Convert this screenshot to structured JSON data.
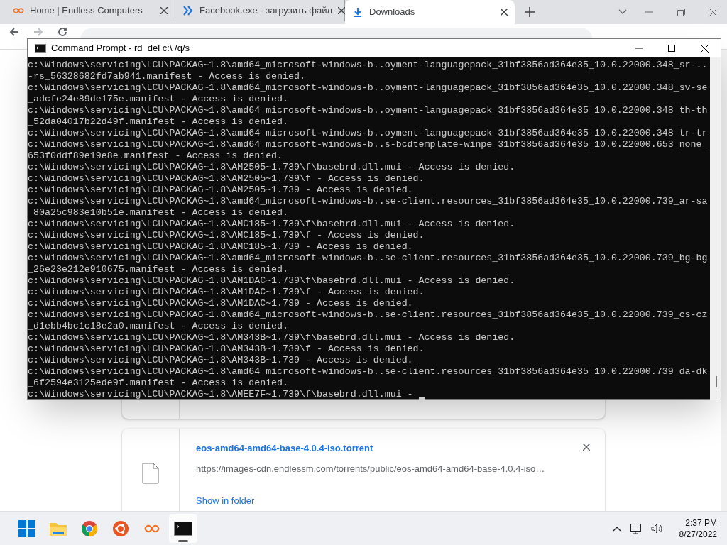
{
  "browser": {
    "tabs": [
      {
        "title": "Home | Endless Computers",
        "selected": false
      },
      {
        "title": "Facebook.exe - загрузить файл",
        "selected": false
      },
      {
        "title": "Downloads",
        "selected": true
      }
    ]
  },
  "downloads": [
    {
      "kind": "hidden"
    },
    {
      "kind": "file",
      "name": "eos-amd64-amd64-base-4.0.4-iso.torrent",
      "url": "https://images-cdn.endlessm.com/torrents/public/eos-amd64-amd64-base-4.0.4-iso…",
      "action": "Show in folder"
    }
  ],
  "console": {
    "title": "Command Prompt - rd  del c:\\ /q/s",
    "lines": [
      "c:\\Windows\\servicing\\LCU\\PACKAG~1.8\\amd64_microsoft-windows-b..oyment-languagepack_31bf3856ad364e35_10.0.22000.348_sr-..",
      "-rs_56328682fd7ab941.manifest - Access is denied.",
      "c:\\Windows\\servicing\\LCU\\PACKAG~1.8\\amd64_microsoft-windows-b..oyment-languagepack_31bf3856ad364e35_10.0.22000.348_sv-se",
      "_adcfe24e89de175e.manifest - Access is denied.",
      "c:\\Windows\\servicing\\LCU\\PACKAG~1.8\\amd64_microsoft-windows-b..oyment-languagepack_31bf3856ad364e35_10.0.22000.348_th-th",
      "_52da04017b22d49f.manifest - Access is denied.",
      "c:\\Windows\\servicing\\LCU\\PACKAG~1.8\\amd64 microsoft-windows-b..oyment-languagepack 31bf3856ad364e35 10.0.22000.348 tr-tr",
      "c:\\Windows\\servicing\\LCU\\PACKAG~1.8\\amd64_microsoft-windows-b..s-bcdtemplate-winpe_31bf3856ad364e35_10.0.22000.653_none_",
      "653f0ddf89e19e8e.manifest - Access is denied.",
      "c:\\Windows\\servicing\\LCU\\PACKAG~1.8\\AM2505~1.739\\f\\basebrd.dll.mui - Access is denied.",
      "c:\\Windows\\servicing\\LCU\\PACKAG~1.8\\AM2505~1.739\\f - Access is denied.",
      "c:\\Windows\\servicing\\LCU\\PACKAG~1.8\\AM2505~1.739 - Access is denied.",
      "c:\\Windows\\servicing\\LCU\\PACKAG~1.8\\amd64_microsoft-windows-b..se-client.resources_31bf3856ad364e35_10.0.22000.739_ar-sa",
      "_80a25c983e10b51e.manifest - Access is denied.",
      "c:\\Windows\\servicing\\LCU\\PACKAG~1.8\\AMC185~1.739\\f\\basebrd.dll.mui - Access is denied.",
      "c:\\Windows\\servicing\\LCU\\PACKAG~1.8\\AMC185~1.739\\f - Access is denied.",
      "c:\\Windows\\servicing\\LCU\\PACKAG~1.8\\AMC185~1.739 - Access is denied.",
      "c:\\Windows\\servicing\\LCU\\PACKAG~1.8\\amd64_microsoft-windows-b..se-client.resources_31bf3856ad364e35_10.0.22000.739_bg-bg",
      "_26e23e212e910675.manifest - Access is denied.",
      "c:\\Windows\\servicing\\LCU\\PACKAG~1.8\\AM1DAC~1.739\\f\\basebrd.dll.mui - Access is denied.",
      "c:\\Windows\\servicing\\LCU\\PACKAG~1.8\\AM1DAC~1.739\\f - Access is denied.",
      "c:\\Windows\\servicing\\LCU\\PACKAG~1.8\\AM1DAC~1.739 - Access is denied.",
      "c:\\Windows\\servicing\\LCU\\PACKAG~1.8\\amd64_microsoft-windows-b..se-client.resources_31bf3856ad364e35_10.0.22000.739_cs-cz",
      "_d1ebb4bc1c18e2a0.manifest - Access is denied.",
      "c:\\Windows\\servicing\\LCU\\PACKAG~1.8\\AM343B~1.739\\f\\basebrd.dll.mui - Access is denied.",
      "c:\\Windows\\servicing\\LCU\\PACKAG~1.8\\AM343B~1.739\\f - Access is denied.",
      "c:\\Windows\\servicing\\LCU\\PACKAG~1.8\\AM343B~1.739 - Access is denied.",
      "c:\\Windows\\servicing\\LCU\\PACKAG~1.8\\amd64_microsoft-windows-b..se-client.resources_31bf3856ad364e35_10.0.22000.739_da-dk",
      "_6f2594e3125ede9f.manifest - Access is denied.",
      "c:\\Windows\\servicing\\LCU\\PACKAG~1.8\\AMEE7F~1.739\\f\\basebrd.dll.mui - "
    ]
  },
  "taskbar": {
    "apps": [
      {
        "selected": false
      },
      {
        "selected": false
      },
      {
        "selected": false
      },
      {
        "selected": false
      },
      {
        "selected": false
      },
      {
        "selected": true
      }
    ],
    "time": "2:37 PM",
    "date": "8/27/2022"
  }
}
